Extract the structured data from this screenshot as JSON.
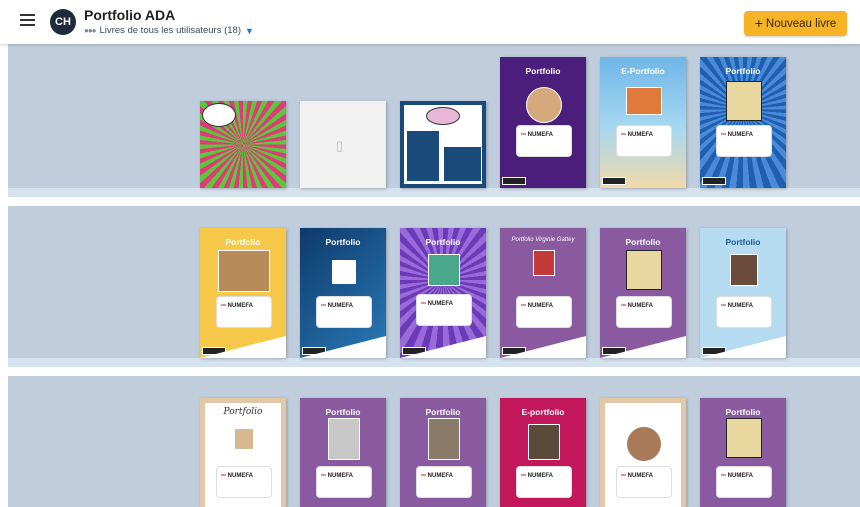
{
  "header": {
    "initials": "CH",
    "title": "Portfolio ADA",
    "subtitle": "Livres de tous les utilisateurs (18)",
    "new_button_label": "Nouveau livre",
    "accent_color": "#f5b325"
  },
  "books": {
    "b1": {
      "title": ""
    },
    "b2": {
      "title": ""
    },
    "b3": {
      "title": ""
    },
    "b4": {
      "title": "Portfolio"
    },
    "b5": {
      "title": "E-Portfolio"
    },
    "b6": {
      "title": "Portfolio"
    },
    "b7": {
      "title": "Portfolio"
    },
    "b8": {
      "title": "Portfolio"
    },
    "b9": {
      "title": "Portfolio"
    },
    "b10": {
      "title": "Portfolio Virginie Gattey"
    },
    "b11": {
      "title": "Portfolio"
    },
    "b12": {
      "title": "Portfolio"
    },
    "b13": {
      "title": "Portfolio"
    },
    "b14": {
      "title": "Portfolio"
    },
    "b15": {
      "title": "Portfolio"
    },
    "b16": {
      "title": "E-portfolio"
    },
    "b17": {
      "title": ""
    },
    "b18": {
      "title": "Portfolio"
    }
  },
  "brand": {
    "logo_text": "NUMEFA"
  }
}
